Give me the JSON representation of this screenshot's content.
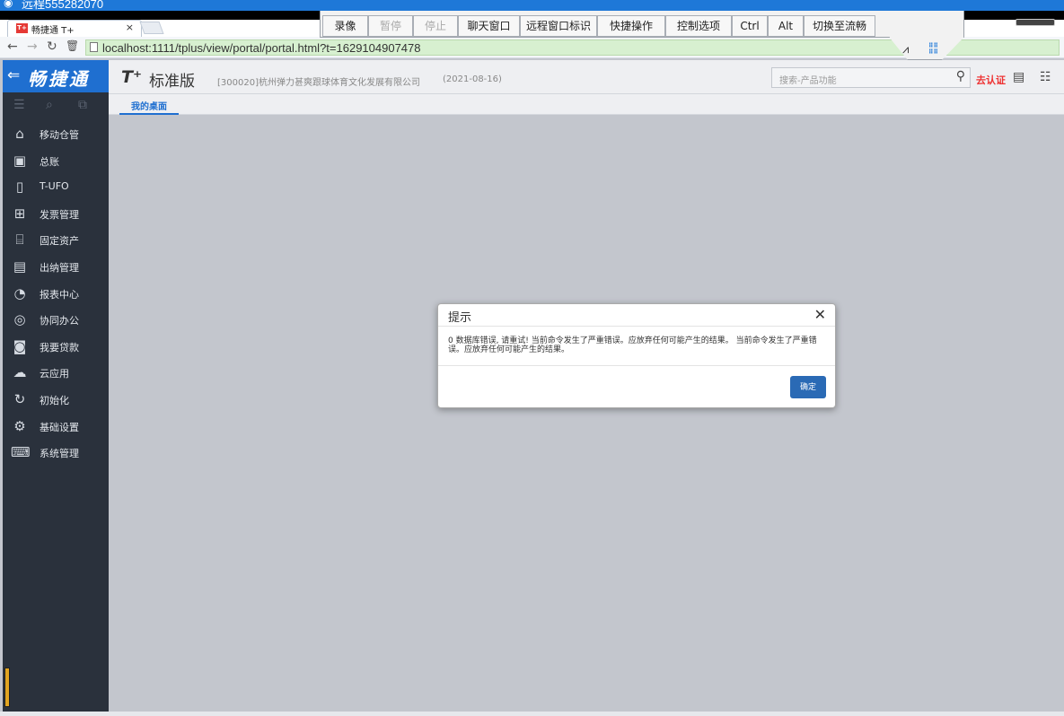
{
  "remote": {
    "title": "远程555282070",
    "toolbar": [
      "录像",
      "暂停",
      "停止",
      "聊天窗口",
      "远程窗口标识",
      "快捷操作",
      "控制选项",
      "Ctrl",
      "Alt",
      "切换至流畅"
    ],
    "disabled": [
      "暂停",
      "停止"
    ]
  },
  "browser": {
    "tab_title": "畅捷通 T+",
    "tab_close": "×",
    "url": "localhost:1111/tplus/view/portal/portal.html?t=1629104907478"
  },
  "app": {
    "brand": "畅捷通",
    "logo_t": "T⁺",
    "edition": "标准版",
    "company": "[300020]杭州弹力甚爽跟球体育文化发展有限公司",
    "date": "(2021-08-16)",
    "search_placeholder": "搜索-产品功能",
    "cert_label": "去认证",
    "desk_tab": "我的桌面"
  },
  "sidebar": {
    "items": [
      {
        "label": "移动仓管",
        "icon": "warehouse-icon"
      },
      {
        "label": "总账",
        "icon": "ledger-icon"
      },
      {
        "label": "T-UFO",
        "icon": "ufo-icon"
      },
      {
        "label": "发票管理",
        "icon": "invoice-icon"
      },
      {
        "label": "固定资产",
        "icon": "bank-icon"
      },
      {
        "label": "出纳管理",
        "icon": "cashier-icon"
      },
      {
        "label": "报表中心",
        "icon": "pie-chart-icon"
      },
      {
        "label": "协同办公",
        "icon": "collab-icon"
      },
      {
        "label": "我要贷款",
        "icon": "money-icon"
      },
      {
        "label": "云应用",
        "icon": "cloud-icon"
      },
      {
        "label": "初始化",
        "icon": "refresh-icon"
      },
      {
        "label": "基础设置",
        "icon": "settings-icon"
      },
      {
        "label": "系统管理",
        "icon": "system-icon"
      }
    ]
  },
  "dialog": {
    "title": "提示",
    "message": "0 数据库错误, 请重试! 当前命令发生了严重错误。应放弃任何可能产生的结果。 当前命令发生了严重错误。应放弃任何可能产生的结果。",
    "ok_label": "确定",
    "close": "✕"
  }
}
